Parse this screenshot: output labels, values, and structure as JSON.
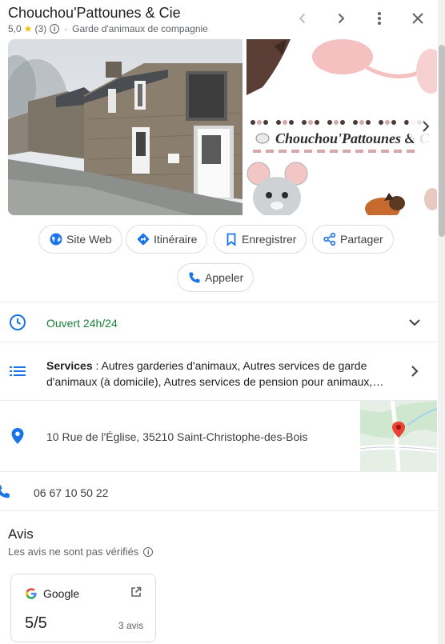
{
  "place": {
    "name": "Chouchou'Pattounes & Cie",
    "rating": "5,0",
    "review_count": "(3)",
    "category": "Garde d'animaux de compagnie"
  },
  "header_icons": [
    "chevron-left-icon",
    "chevron-right-icon",
    "more-vert-icon",
    "close-icon"
  ],
  "photo_banner_text": "Chouchou'Pattounes & C",
  "actions": {
    "website": "Site Web",
    "directions": "Itinéraire",
    "save": "Enregistrer",
    "share": "Partager",
    "call": "Appeler"
  },
  "hours": {
    "text": "Ouvert 24h/24"
  },
  "services": {
    "label": "Services",
    "line1": " : Autres garderies d'animaux, Autres services de garde",
    "line2": "d'animaux (à domicile), Autres services de pension pour animaux,…"
  },
  "address": "10 Rue de l'Église, 35210 Saint-Christophe-des-Bois",
  "phone": "06 67 10 50 22",
  "reviews": {
    "title": "Avis",
    "subtitle": "Les avis ne sont pas vérifiés",
    "source": "Google",
    "score": "5/5",
    "count": "3 avis"
  },
  "colors": {
    "accent_blue": "#1a73e8",
    "open_green": "#188038",
    "star_yellow": "#fbbc04",
    "pin_red": "#ea4335"
  }
}
